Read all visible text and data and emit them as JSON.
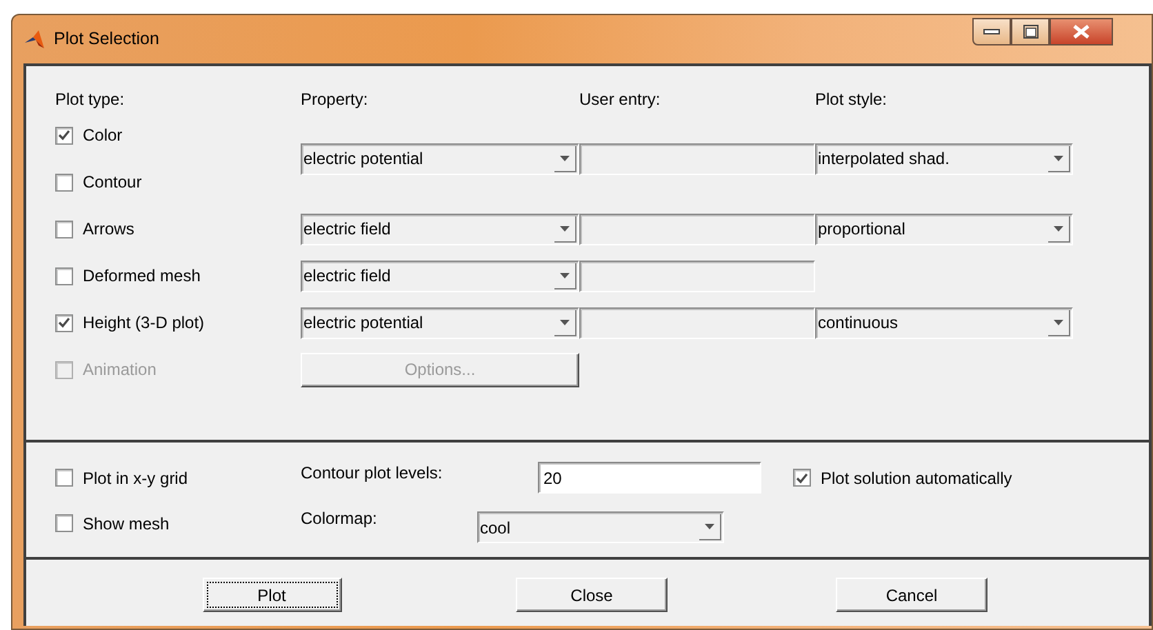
{
  "window": {
    "title": "Plot Selection"
  },
  "columns": [
    "Plot type:",
    "Property:",
    "User entry:",
    "Plot style:"
  ],
  "plot_types": [
    {
      "label": "Color",
      "checked": true,
      "disabled": false,
      "property": {
        "kind": "dropdown",
        "value": "electric potential"
      },
      "user_entry": {
        "disabled": true
      },
      "plot_style": {
        "value": "interpolated shad."
      }
    },
    {
      "label": "Contour",
      "checked": false,
      "disabled": false
    },
    {
      "label": "Arrows",
      "checked": false,
      "disabled": false,
      "property": {
        "kind": "dropdown",
        "value": "electric field"
      },
      "user_entry": {
        "disabled": true
      },
      "plot_style": {
        "value": "proportional"
      }
    },
    {
      "label": "Deformed mesh",
      "checked": false,
      "disabled": false,
      "property": {
        "kind": "dropdown",
        "value": "electric field"
      },
      "user_entry": {
        "disabled": true
      }
    },
    {
      "label": "Height (3-D plot)",
      "checked": true,
      "disabled": false,
      "property": {
        "kind": "dropdown",
        "value": "electric potential"
      },
      "user_entry": {
        "disabled": true
      },
      "plot_style": {
        "value": "continuous"
      }
    },
    {
      "label": "Animation",
      "checked": false,
      "disabled": true,
      "property": {
        "kind": "button",
        "value": "Options...",
        "disabled": true
      }
    }
  ],
  "options": [
    {
      "label": "Plot in x-y grid",
      "checked": false
    },
    {
      "label": "Show mesh",
      "checked": false
    }
  ],
  "contour_levels": {
    "label": "Contour plot levels:",
    "value": "20"
  },
  "colormap": {
    "label": "Colormap:",
    "value": "cool"
  },
  "plot_automatically": {
    "label": "Plot solution automatically",
    "checked": true
  },
  "buttons": [
    {
      "label": "Plot",
      "focused": true
    },
    {
      "label": "Close",
      "focused": false
    },
    {
      "label": "Cancel",
      "focused": false
    }
  ]
}
